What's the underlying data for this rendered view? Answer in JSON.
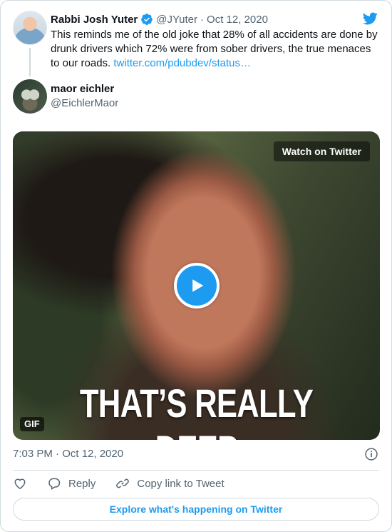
{
  "tweet": {
    "author_name": "Rabbi Josh Yuter",
    "author_handle": "@JYuter",
    "separator": "·",
    "date": "Oct 12, 2020",
    "text": "This reminds me of the old joke that 28% of all accidents are done by drunk drivers which 72% were from sober drivers, the true menaces to our roads. ",
    "link_text": "twitter.com/pdubdev/status…"
  },
  "quoted": {
    "author_name": "maor eichler",
    "author_handle": "@EichlerMaor"
  },
  "media": {
    "watch_label": "Watch on Twitter",
    "caption": "THAT’S REALLY DEEP",
    "gif_label": "GIF"
  },
  "footer": {
    "timestamp": "7:03 PM · Oct 12, 2020",
    "reply_label": "Reply",
    "copy_link_label": "Copy link to Tweet",
    "explore_label": "Explore what's happening on Twitter"
  },
  "colors": {
    "accent": "#1d9bf0",
    "text": "#0f1419",
    "muted": "#536471",
    "border": "#cfd9de"
  },
  "icons": [
    "verified-icon",
    "twitter-logo-icon",
    "play-icon",
    "info-icon",
    "heart-icon",
    "reply-icon",
    "link-icon"
  ]
}
